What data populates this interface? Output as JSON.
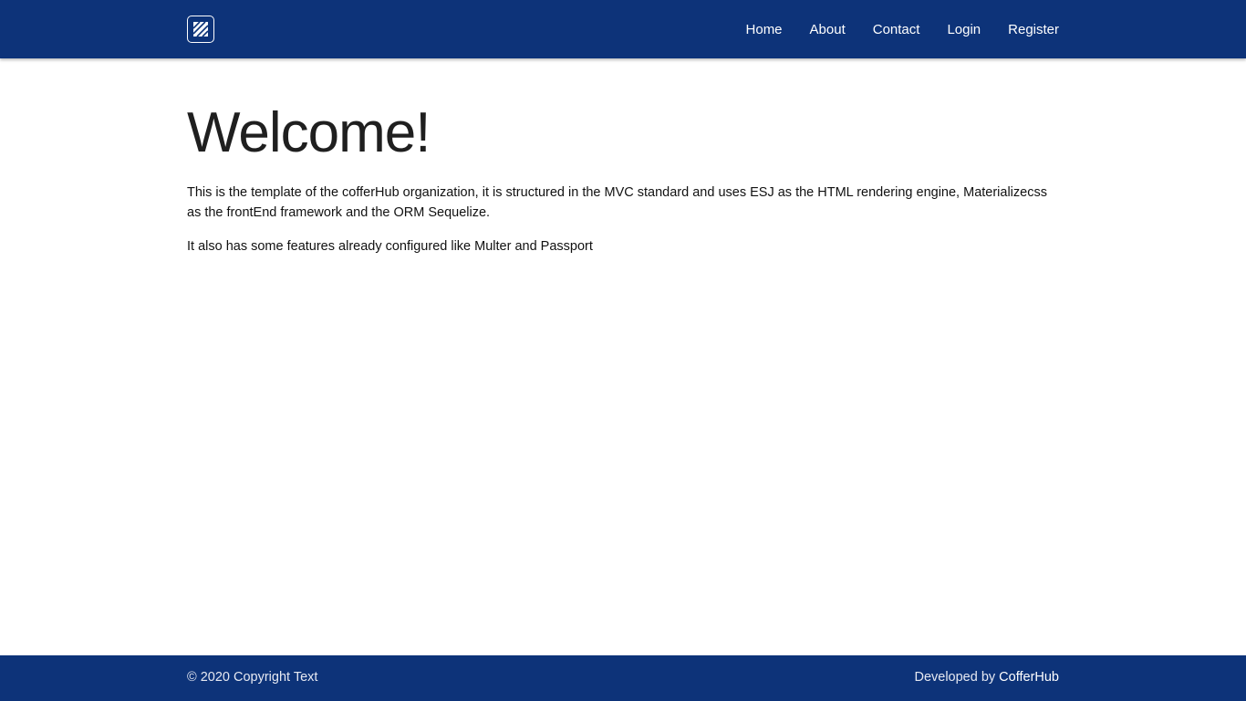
{
  "header": {
    "nav": [
      {
        "label": "Home"
      },
      {
        "label": "About"
      },
      {
        "label": "Contact"
      },
      {
        "label": "Login"
      },
      {
        "label": "Register"
      }
    ]
  },
  "main": {
    "title": "Welcome!",
    "paragraph1": "This is the template of the cofferHub organization, it is structured in the MVC standard and uses ESJ as the HTML rendering engine, Materializecss as the frontEnd framework and the ORM Sequelize.",
    "paragraph2": "It also has some features already configured like Multer and Passport"
  },
  "footer": {
    "copyright": "© 2020 Copyright Text",
    "developed_prefix": "Developed by ",
    "developed_link": "CofferHub"
  },
  "colors": {
    "primary": "#0d3379",
    "text": "#222222",
    "background": "#ffffff"
  }
}
